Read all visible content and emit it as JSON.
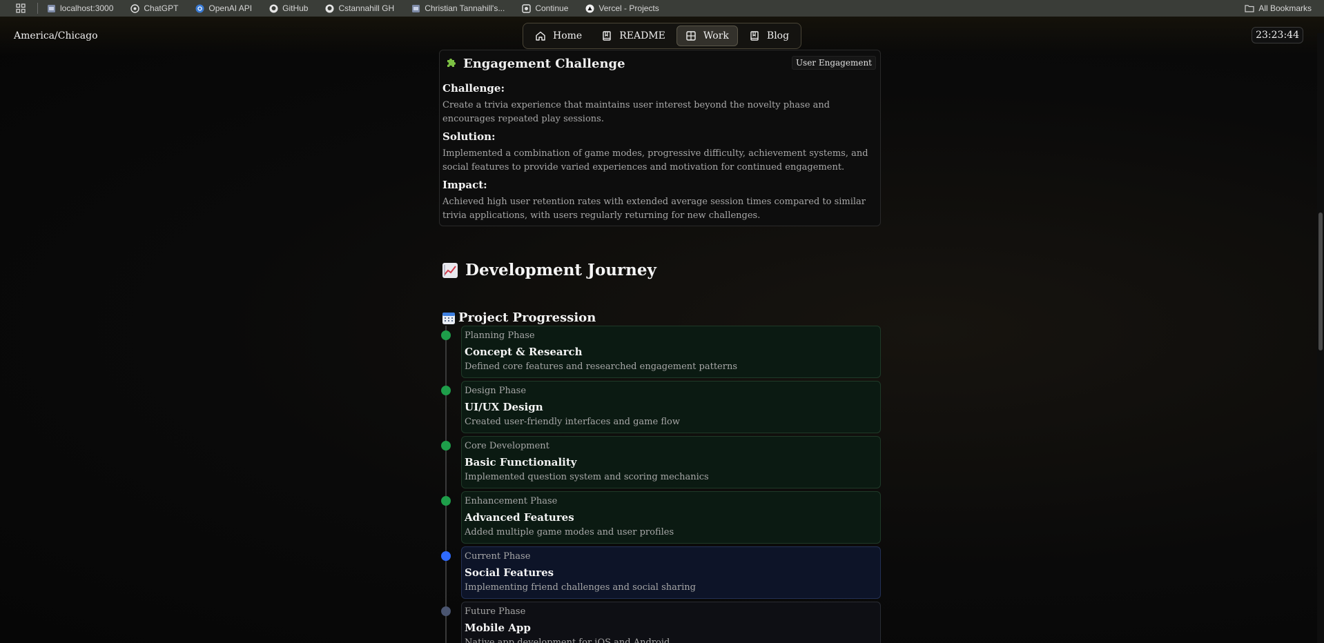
{
  "bookmarks": {
    "items": [
      {
        "label": "localhost:3000",
        "icon": "page-icon"
      },
      {
        "label": "ChatGPT",
        "icon": "openai-icon"
      },
      {
        "label": "OpenAI API",
        "icon": "openai-icon"
      },
      {
        "label": "GitHub",
        "icon": "github-icon"
      },
      {
        "label": "Cstannahill GH",
        "icon": "github-icon"
      },
      {
        "label": "Christian Tannahill's...",
        "icon": "page-icon"
      },
      {
        "label": "Continue",
        "icon": "continue-icon"
      },
      {
        "label": "Vercel - Projects",
        "icon": "vercel-icon"
      }
    ],
    "all_bookmarks": "All Bookmarks"
  },
  "header": {
    "timezone": "America/Chicago",
    "clock": "23:23:44"
  },
  "nav": {
    "items": [
      {
        "label": "Home",
        "icon": "home-icon",
        "active": false
      },
      {
        "label": "README",
        "icon": "book-icon",
        "active": false
      },
      {
        "label": "Work",
        "icon": "grid-icon",
        "active": true
      },
      {
        "label": "Blog",
        "icon": "book-icon",
        "active": false
      }
    ]
  },
  "challenge_card": {
    "title": "Engagement Challenge",
    "tag": "User Engagement",
    "challenge_label": "Challenge:",
    "challenge_text": "Create a trivia experience that maintains user interest beyond the novelty phase and encourages repeated play sessions.",
    "solution_label": "Solution:",
    "solution_text": "Implemented a combination of game modes, progressive difficulty, achievement systems, and social features to provide varied experiences and motivation for continued engagement.",
    "impact_label": "Impact:",
    "impact_text": "Achieved high user retention rates with extended average session times compared to similar trivia applications, with users regularly returning for new challenges."
  },
  "journey": {
    "title": "Development Journey",
    "progression_title": "Project Progression",
    "steps": [
      {
        "phase": "Planning Phase",
        "title": "Concept & Research",
        "desc": "Defined core features and researched engagement patterns",
        "status": "done"
      },
      {
        "phase": "Design Phase",
        "title": "UI/UX Design",
        "desc": "Created user-friendly interfaces and game flow",
        "status": "done"
      },
      {
        "phase": "Core Development",
        "title": "Basic Functionality",
        "desc": "Implemented question system and scoring mechanics",
        "status": "done"
      },
      {
        "phase": "Enhancement Phase",
        "title": "Advanced Features",
        "desc": "Added multiple game modes and user profiles",
        "status": "done"
      },
      {
        "phase": "Current Phase",
        "title": "Social Features",
        "desc": "Implementing friend challenges and social sharing",
        "status": "current"
      },
      {
        "phase": "Future Phase",
        "title": "Mobile App",
        "desc": "Native app development for iOS and Android",
        "status": "future"
      }
    ]
  },
  "colors": {
    "done_dot": "#1e9e4a",
    "current_dot": "#2f6bff",
    "future_dot": "#4a5570"
  }
}
